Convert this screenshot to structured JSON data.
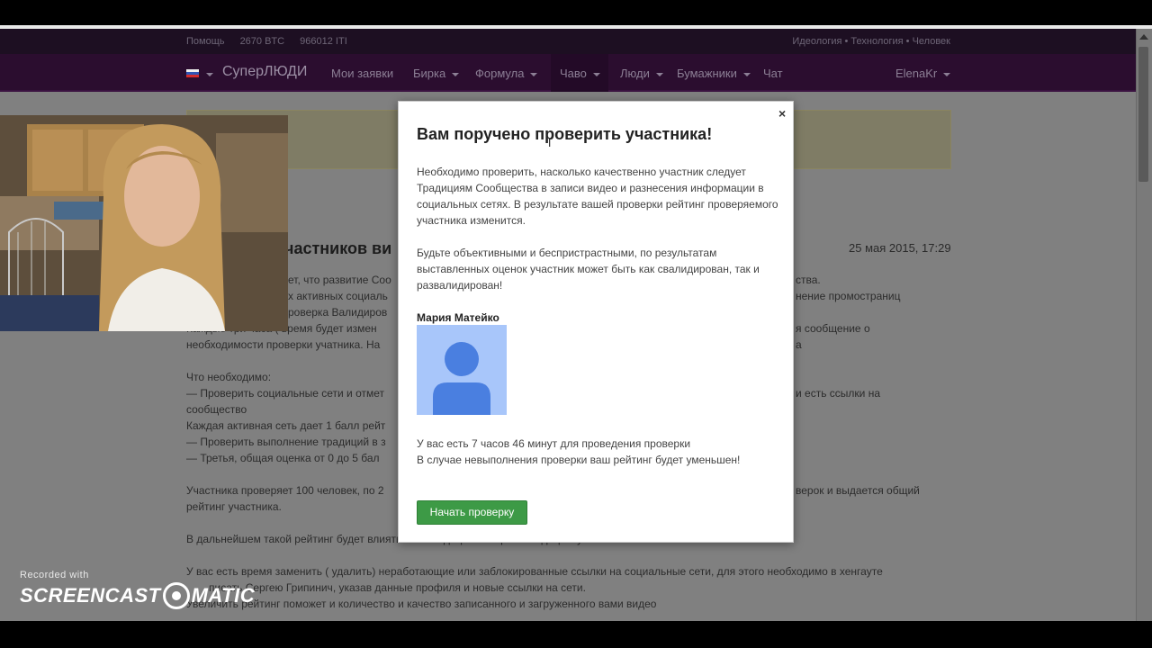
{
  "topbar": {
    "help": "Помощь",
    "btc": "2670 BTC",
    "iti": "966012 ITI",
    "tagline": "Идеология • Технология • Человек"
  },
  "nav": {
    "brand": "СуперЛЮДИ",
    "items": [
      "Мои заявки",
      "Бирка",
      "Формула",
      "Чаво",
      "Люди",
      "Бумажники",
      "Чат"
    ],
    "user": "ElenaKr"
  },
  "article": {
    "title_fragment": "частников ви",
    "date": "25 мая 2015, 17:29",
    "lines": [
      "ет, что развитие Соо",
      "х активных социаль",
      "роверка Валидиров",
      "Каждые три часа ( время будет измен",
      "необходимости проверки учатника. На",
      "Что необходимо:",
      "— Проверить социальные сети и отмет",
      "сообщество",
      "Каждая активная сеть дает 1 балл рейт",
      "— Проверить выполнение традиций в з",
      "— Третья, общая оценка от 0 до 5 бал",
      "Участника проверяет 100 человек, по 2",
      "рейтинг участника.",
      "В дальнейшем такой рейтинг будет влиять на валидацию или развалидацию участника.",
      "У вас есть время заменить ( удалить) неработающие или заблокированные ссылки на социальные сети, для этого необходимо в хенгауте",
      "писать Сергею Грипинич, указав данные профиля и новые ссылки на сети.",
      "Увеличить рейтинг поможет и количество и качество записанного и загруженного вами видео"
    ],
    "right_lines": [
      "ства.",
      "нение промостраниц",
      "я сообщение о",
      "а",
      "и есть ссылки на",
      "верок и выдается общий"
    ]
  },
  "modal": {
    "close": "×",
    "title": "Вам поручено проверить участника!",
    "p1": "Необходимо проверить, насколько качественно участник следует Традициям Сообщества в записи видео и разнесения информации в социальных сетях. В результате вашей проверки рейтинг проверяемого участника изменится.",
    "p2": "Будьте объективными и беспристрастными, по результатам выставленных оценок участник может быть как свалидирован, так и развалидирован!",
    "member_name": "Мария Матейко",
    "time_line": "У вас есть 7 часов 46 минут для проведения проверки",
    "warn_line": "В случае невыполнения проверки ваш рейтинг будет уменьшен!",
    "button": "Начать проверку"
  },
  "watermark": {
    "recorded": "Recorded with",
    "brand_left": "SCREENCAST",
    "brand_right": "MATIC"
  },
  "colors": {
    "nav_bg": "#2b0d2f",
    "button_green": "#3d9a46",
    "avatar_bg": "#a8c6fa",
    "avatar_fg": "#4a7fe0"
  }
}
